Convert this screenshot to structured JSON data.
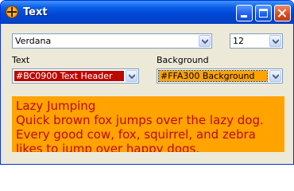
{
  "window": {
    "title": "Text"
  },
  "titlebar_buttons": {
    "minimize": "minimize-icon",
    "maximize": "maximize-icon",
    "close": "close-icon"
  },
  "font": {
    "family": "Verdana",
    "size": "12"
  },
  "text_color": {
    "label": "Text",
    "value": "#BC0900 Text Header",
    "color": "#BC0900"
  },
  "background_color": {
    "label": "Background",
    "value": "#FFA300 Background",
    "color": "#FFA300"
  },
  "preview": {
    "header": "Lazy Jumping",
    "body": "Quick brown fox jumps over the lazy dog. Every good cow, fox, squirrel, and zebra likes to jump over happy dogs."
  }
}
